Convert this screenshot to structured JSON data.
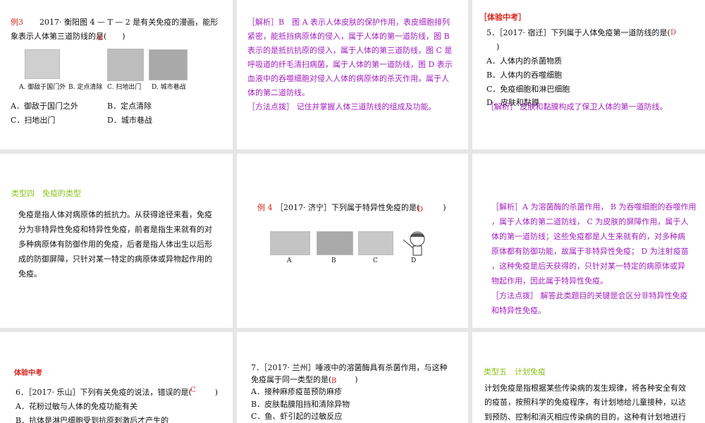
{
  "slide1": {
    "label": "例3",
    "question_line1": "2017· 衡阳图 4 — T — 2 是有关免疫的漫画，能形",
    "question_line2": "象表示人体第三道防线的是(　　)",
    "answer": "B",
    "image_captions": [
      "A. 御敌于国门外",
      "B. 定点清除",
      "C. 扫地出门",
      "D. 城市巷战"
    ],
    "options": [
      "A．御敌于国门之外",
      "B．定点清除",
      "C．扫地出门",
      "D．城市巷战"
    ]
  },
  "slide2": {
    "lines": [
      "［解析］B　图 A 表示人体皮肤的保护作用，表皮细胞排列",
      "紧密，能抵挡病原体的侵入，属于人体的第一道防线，图 B",
      "表示的是抵抗抗原的侵入，属于人体的第三道防线，图 C 是",
      "呼吸道的纤毛清扫病菌，属于人体的第一道防线，图 D 表示",
      "血液中的吞噬细胞对侵入人体的病原体的杀灭作用，属于人",
      "体的第二道防线。",
      "［方法点拨］ 记住并掌握人体三道防线的组成及功能。"
    ]
  },
  "slide3": {
    "header": "［体验中考］",
    "question_line1": "5．［2017· 宿迁］下列属于人体免疫第一道防线的是(",
    "question_line2": ")",
    "answer": "D",
    "options": [
      "A．人体内的杀菌物质",
      "B．人体内的吞噬细胞",
      "C．免疫细胞和淋巴细胞",
      "D．皮肤和黏膜"
    ],
    "analysis": "［解析］ 皮肤和黏膜构成了保卫人体的第一道防线。"
  },
  "slide4": {
    "header": "类型四　免疫的类型",
    "lines": [
      "免疫是指人体对病原体的抵抗力。从获得途径来看，免疫",
      "分为非特异性免疫和特异性免疫，前者是指生来就有的对",
      "多种病原体有防御作用的免疫，后者是指人体出生以后形",
      "成的防御屏障，只针对某一特定的病原体或异物起作用的",
      "免疫。"
    ]
  },
  "slide5": {
    "label": "例 4",
    "question": "［2017· 济宁］下列属于特异性免疫的是(　　　)",
    "answer": "D",
    "image_captions": [
      "A",
      "B",
      "C",
      "D"
    ]
  },
  "slide6": {
    "lines": [
      "［解析］A 为溶菌酶的杀菌作用， B 为吞噬细胞的吞噬作用",
      "，属于人体的第二道防线， C 为皮肤的屏障作用，属于人",
      "体的第一道防线；这些免疫都是人生来就有的，对多种病",
      "原体都有防御功能，故属于非特异性免疫； D 为注射疫苗",
      "，这种免疫是后天获得的，只针对某一特定的病原体或异",
      "物起作用，因此属于特异性免疫。",
      "［方法点拨］ 解答此类题目的关键是会区分非特异性免疫",
      "和特异性免疫。"
    ]
  },
  "slide7": {
    "header": "体验中考",
    "question": "6．［2017· 乐山］下列有关免疫的说法，错误的是(　　　)",
    "answer": "C",
    "options": [
      "A．花粉过敏与人体的免疫功能有关",
      "B．抗体是淋巴细胞受到抗原刺激后才产生的"
    ]
  },
  "slide8": {
    "question_line1": "7．［2017· 兰州］唾液中的溶菌酶具有杀菌作用，与这种",
    "question_line2": "免疫属于同一类型的是(　　　)",
    "answer": "B",
    "options": [
      "A．接种麻疹疫苗预防麻疹",
      "B．皮肤黏膜阻挡和清除异物",
      "C．鱼、虾引起的过敏反应"
    ]
  },
  "slide9": {
    "header": "类型五　计划免疫",
    "lines": [
      "计划免疫是指根据某些传染病的发生规律，将各种安全有效",
      "的疫苗，按照科学的免疫程序，有计划地给儿童接种，以达",
      "到预防、控制和消灭相应传染病的目的，这种有计划地进行"
    ]
  }
}
